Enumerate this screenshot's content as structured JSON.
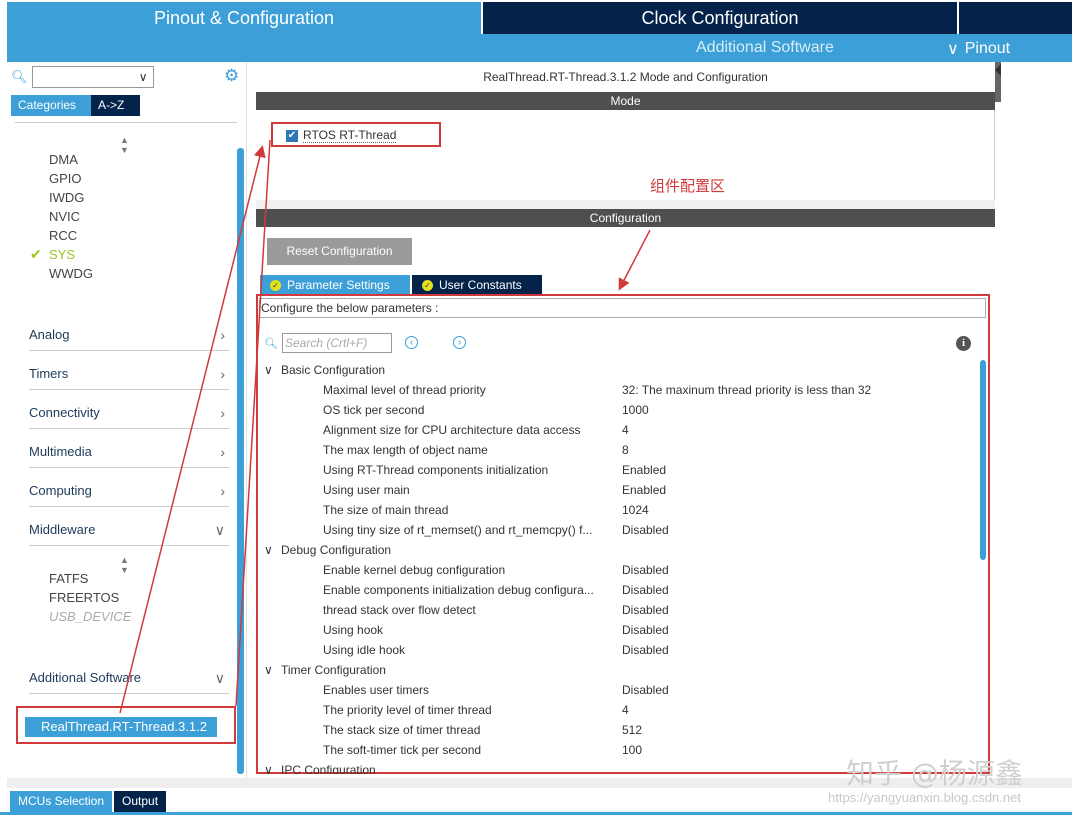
{
  "header": {
    "tab_pinout": "Pinout & Configuration",
    "tab_clock": "Clock Configuration",
    "additional_software": "Additional Software",
    "pinout_menu": "Pinout"
  },
  "left": {
    "category_tabs": [
      "Categories",
      "A->Z"
    ],
    "system_core_items": [
      "DMA",
      "GPIO",
      "IWDG",
      "NVIC",
      "RCC",
      "SYS",
      "WWDG"
    ],
    "sections": [
      "Analog",
      "Timers",
      "Connectivity",
      "Multimedia",
      "Computing",
      "Middleware"
    ],
    "middleware_items": [
      "FATFS",
      "FREERTOS",
      "USB_DEVICE"
    ],
    "additional_software": "Additional Software",
    "selected_pack": "RealThread.RT-Thread.3.1.2"
  },
  "main": {
    "title": "RealThread.RT-Thread.3.1.2 Mode and Configuration",
    "mode_header": "Mode",
    "rtos_checkbox": "RTOS RT-Thread",
    "annotation": "组件配置区",
    "config_header": "Configuration",
    "reset_button": "Reset Configuration",
    "param_tabs": [
      "Parameter Settings",
      "User Constants"
    ],
    "configure_label": "Configure the below parameters :",
    "search_placeholder": "Search (Crtl+F)",
    "groups": [
      {
        "name": "Basic Configuration",
        "params": [
          {
            "name": "Maximal level of thread priority",
            "value": "32: The maxinum thread priority is less than 32"
          },
          {
            "name": "OS tick per second",
            "value": "1000"
          },
          {
            "name": "Alignment size for CPU architecture data access",
            "value": "4"
          },
          {
            "name": "The max length of object name",
            "value": "8"
          },
          {
            "name": "Using RT-Thread components initialization",
            "value": "Enabled"
          },
          {
            "name": "Using user main",
            "value": "Enabled"
          },
          {
            "name": "The size of main thread",
            "value": "1024"
          },
          {
            "name": "Using tiny size of rt_memset() and rt_memcpy() f...",
            "value": "Disabled"
          }
        ]
      },
      {
        "name": "Debug Configuration",
        "params": [
          {
            "name": "Enable kernel debug configuration",
            "value": "Disabled"
          },
          {
            "name": "Enable components initialization debug configura...",
            "value": "Disabled"
          },
          {
            "name": "thread stack over flow detect",
            "value": "Disabled"
          },
          {
            "name": "Using hook",
            "value": "Disabled"
          },
          {
            "name": "Using idle hook",
            "value": "Disabled"
          }
        ]
      },
      {
        "name": "Timer Configuration",
        "params": [
          {
            "name": "Enables user timers",
            "value": "Disabled"
          },
          {
            "name": "The priority level of timer thread",
            "value": "4"
          },
          {
            "name": "The stack size of timer thread",
            "value": "512"
          },
          {
            "name": "The soft-timer tick per second",
            "value": "100"
          }
        ]
      },
      {
        "name": "IPC Configuration",
        "params": []
      }
    ]
  },
  "bottom": {
    "tabs": [
      "MCUs Selection",
      "Output"
    ]
  },
  "watermark": "知乎 @杨源鑫",
  "url_watermark": "https://yangyuanxin.blog.csdn.net",
  "colors": {
    "accent": "#3d9fd8",
    "dark": "#03234b",
    "annotation_red": "#d03a3a",
    "check_green": "#9bc521"
  }
}
